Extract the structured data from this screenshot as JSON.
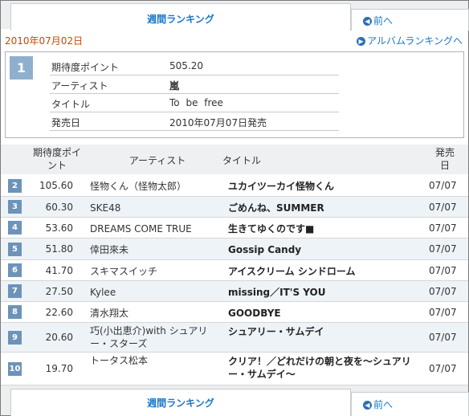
{
  "tabs": {
    "weekly_ranking": "週間ランキング",
    "prev": "前へ"
  },
  "date": "2010年07月02日",
  "album_link": "アルバムランキングへ",
  "feature": {
    "rank": "1",
    "labels": {
      "points": "期待度ポイント",
      "artist": "アーティスト",
      "title": "タイトル",
      "release": "発売日"
    },
    "points": "505.20",
    "artist": "嵐",
    "title": "To be free",
    "release": "2010年07月07日発売"
  },
  "table": {
    "headers": {
      "points": "期待度ポイント",
      "artist": "アーティスト",
      "title": "タイトル",
      "release": "発売日"
    },
    "rows": [
      {
        "rank": "2",
        "points": "105.60",
        "artist": "怪物くん（怪物太郎）",
        "title": "ユカイツーカイ怪物くん",
        "release": "07/07"
      },
      {
        "rank": "3",
        "points": "60.30",
        "artist": "SKE48",
        "title": "ごめんね、SUMMER",
        "release": "07/07"
      },
      {
        "rank": "4",
        "points": "53.60",
        "artist": "DREAMS COME TRUE",
        "title": "生きてゆくのです■",
        "release": "07/07"
      },
      {
        "rank": "5",
        "points": "51.80",
        "artist": "倖田來未",
        "title": "Gossip Candy",
        "release": "07/07"
      },
      {
        "rank": "6",
        "points": "41.70",
        "artist": "スキマスイッチ",
        "title": "アイスクリーム シンドローム",
        "release": "07/07"
      },
      {
        "rank": "7",
        "points": "27.50",
        "artist": "Kylee",
        "title": "missing／IT'S YOU",
        "release": "07/07"
      },
      {
        "rank": "8",
        "points": "22.60",
        "artist": "清水翔太",
        "title": "GOODBYE",
        "release": "07/07"
      },
      {
        "rank": "9",
        "points": "20.60",
        "artist": "巧(小出恵介)with シュアリー・スターズ",
        "title": "シュアリー・サムデイ",
        "release": "07/07"
      },
      {
        "rank": "10",
        "points": "19.70",
        "artist": "トータス松本",
        "title": "クリア！／どれだけの朝と夜を〜シュアリー・サムデイ〜",
        "release": "07/07"
      }
    ]
  },
  "icons": {
    "prev": "arrow-left-circle-icon",
    "album": "arrow-right-circle-icon"
  },
  "colors": {
    "link": "#1b76c8",
    "date": "#c44a00",
    "badge": "#6d93b9",
    "feature_badge": "#8eb0cc"
  }
}
